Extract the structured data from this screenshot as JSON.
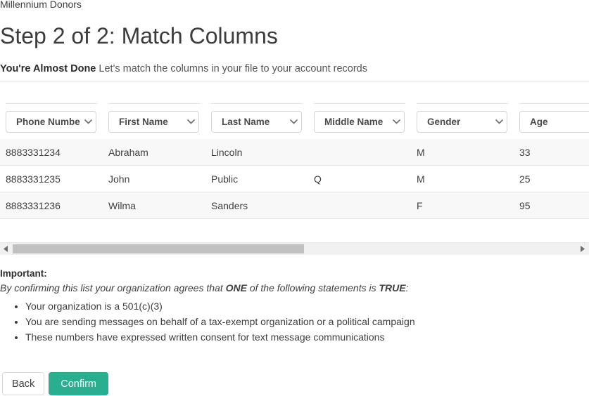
{
  "breadcrumb": "Millennium Donors",
  "page_title": "Step 2 of 2: Match Columns",
  "lead": {
    "strong": "You're Almost Done",
    "text": "Let's match the columns in your file to your account records"
  },
  "table": {
    "column_selectors": [
      {
        "value": "Phone Number",
        "name": "phone-number"
      },
      {
        "value": "First Name",
        "name": "first-name"
      },
      {
        "value": "Last Name",
        "name": "last-name"
      },
      {
        "value": "Middle Name",
        "name": "middle-name"
      },
      {
        "value": "Gender",
        "name": "gender"
      },
      {
        "value": "Age",
        "name": "age"
      },
      {
        "value": "",
        "name": "next-column"
      }
    ],
    "rows": [
      [
        "8883331234",
        "Abraham",
        "Lincoln",
        "",
        "M",
        "33",
        ""
      ],
      [
        "8883331235",
        "John",
        "Public",
        "Q",
        "M",
        "25",
        ""
      ],
      [
        "8883331236",
        "Wilma",
        "Sanders",
        "",
        "F",
        "95",
        ""
      ]
    ]
  },
  "scrollbar": {
    "left_arrow": "scroll-left",
    "right_arrow": "scroll-right"
  },
  "important": {
    "title": "Important:",
    "lead_part1": "By confirming this list your organization agrees that ",
    "lead_bold1": "ONE",
    "lead_part2": " of the following statements is ",
    "lead_bold2": "TRUE",
    "lead_part3": ":",
    "bullets": [
      "Your organization is a 501(c)(3)",
      "You are sending messages on behalf of a tax-exempt organization or a political campaign",
      "These numbers have expressed written consent for text message communications"
    ]
  },
  "actions": {
    "back_label": "Back",
    "confirm_label": "Confirm",
    "confirm_color": "#29ae8f"
  }
}
